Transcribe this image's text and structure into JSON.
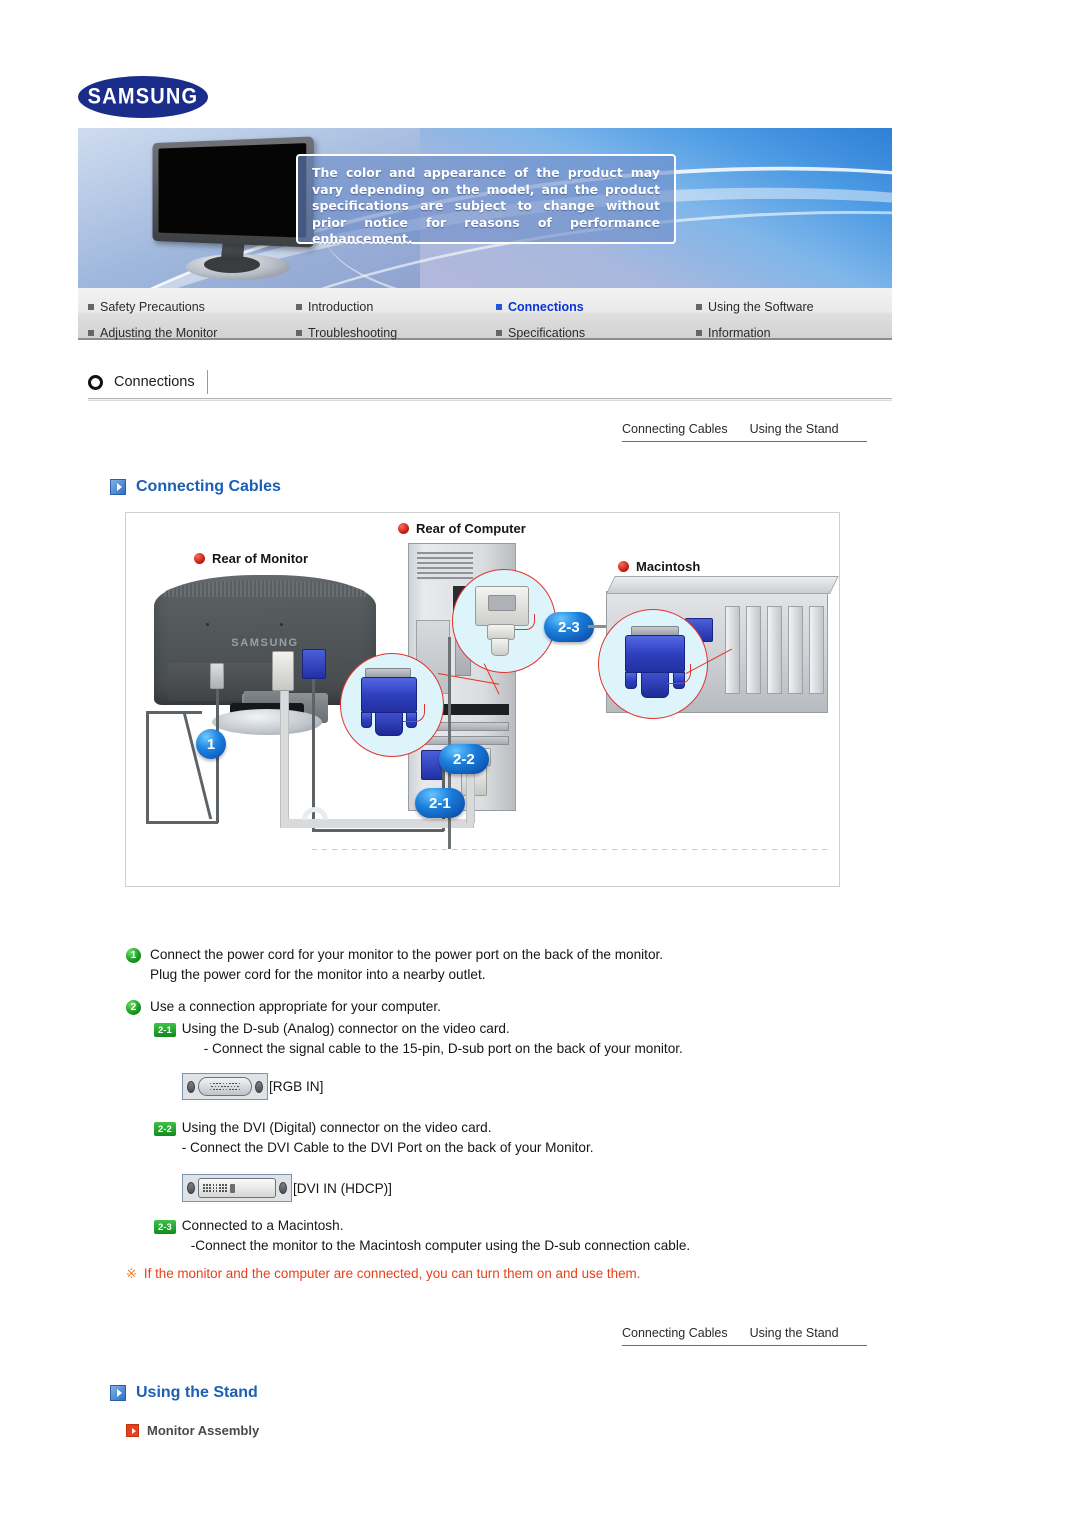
{
  "brand": {
    "logo_text": "SAMSUNG"
  },
  "hero": {
    "notice": "The color and appearance of the product may vary depending on the model, and the product specifications are subject to change without prior notice for reasons of performance enhancement."
  },
  "nav": {
    "items": [
      {
        "label": "Safety Precautions",
        "active": false
      },
      {
        "label": "Introduction",
        "active": false
      },
      {
        "label": "Connections",
        "active": true
      },
      {
        "label": "Using the Software",
        "active": false
      },
      {
        "label": "Adjusting the Monitor",
        "active": false
      },
      {
        "label": "Troubleshooting",
        "active": false
      },
      {
        "label": "Specifications",
        "active": false
      },
      {
        "label": "Information",
        "active": false
      }
    ]
  },
  "section": {
    "title": "Connections"
  },
  "topic_links": [
    {
      "label": "Connecting Cables"
    },
    {
      "label": "Using the Stand"
    }
  ],
  "headings": {
    "connecting_cables": "Connecting Cables",
    "using_the_stand": "Using the Stand",
    "monitor_assembly": "Monitor Assembly"
  },
  "diagram": {
    "labels": {
      "rear_of_monitor": "Rear of Monitor",
      "rear_of_computer": "Rear of Computer",
      "macintosh": "Macintosh"
    },
    "monitor_brand": "SAMSUNG",
    "badges": {
      "one": "1",
      "two_one": "2-1",
      "two_two": "2-2",
      "two_three": "2-3"
    }
  },
  "instructions": {
    "step1": {
      "num": "1",
      "line1": "Connect the power cord for your monitor to the power port on the back of the monitor.",
      "line2": "Plug the power cord for the monitor into a nearby outlet."
    },
    "step2": {
      "num": "2",
      "line1": "Use a connection appropriate for your computer.",
      "sub": [
        {
          "num": "2-1",
          "title": "Using the D-sub (Analog) connector on the video card.",
          "detail": "- Connect the signal cable to the 15-pin, D-sub port on the back of your monitor.",
          "port_label": "[RGB IN]",
          "port_icon": "dsub-port-icon"
        },
        {
          "num": "2-2",
          "title": "Using the DVI (Digital) connector on the video card.",
          "detail": "- Connect the DVI Cable to the DVI Port on the back of your Monitor.",
          "port_label": "[DVI IN (HDCP)]",
          "port_icon": "dvi-port-icon"
        },
        {
          "num": "2-3",
          "title": "Connected to a Macintosh.",
          "detail": "-Connect the monitor to the Macintosh computer using the D-sub connection cable.",
          "port_label": "",
          "port_icon": ""
        }
      ]
    }
  },
  "note": {
    "mark": "※",
    "text": "If the monitor and the computer are connected, you can turn them on and use them."
  },
  "colors": {
    "brand_blue": "#1a2d8a",
    "heading_blue": "#1b5fb5",
    "active_nav": "#0a33d6",
    "note_red": "#e8401a",
    "badge_blue": "#1a7fdb",
    "step_green": "#1d9b22",
    "bubble_outline": "#e0342a"
  }
}
